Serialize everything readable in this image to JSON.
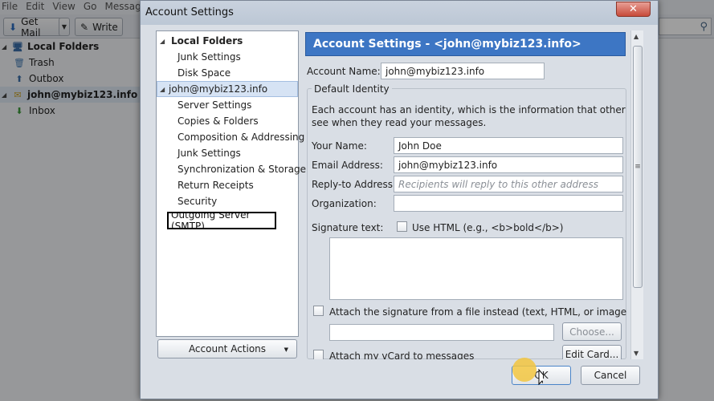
{
  "menubar": [
    "File",
    "Edit",
    "View",
    "Go",
    "Message"
  ],
  "toolbar": {
    "get_mail": "Get Mail",
    "write": "Write"
  },
  "folder_pane": {
    "local_folders": "Local Folders",
    "trash": "Trash",
    "outbox": "Outbox",
    "account": "john@mybiz123.info",
    "inbox": "Inbox"
  },
  "dialog": {
    "title": "Account Settings",
    "close": "✕",
    "tree": {
      "local_folders": "Local Folders",
      "junk_settings_1": "Junk Settings",
      "disk_space": "Disk Space",
      "account": "john@mybiz123.info",
      "server_settings": "Server Settings",
      "copies_folders": "Copies & Folders",
      "composition": "Composition & Addressing",
      "junk_settings_2": "Junk Settings",
      "sync_storage": "Synchronization & Storage",
      "return_receipts": "Return Receipts",
      "security": "Security",
      "outgoing_server": "Outgoing Server (SMTP)"
    },
    "account_actions": "Account Actions",
    "header": "Account Settings - <john@mybiz123.info>",
    "account_name_label": "Account Name:",
    "account_name_value": "john@mybiz123.info",
    "default_identity": "Default Identity",
    "identity_desc_1": "Each account has an identity, which is the information that other people",
    "identity_desc_2": "see when they read your messages.",
    "your_name_label": "Your Name:",
    "your_name_value": "John Doe",
    "email_label": "Email Address:",
    "email_value": "john@mybiz123.info",
    "reply_to_label": "Reply-to Address:",
    "reply_to_placeholder": "Recipients will reply to this other address",
    "organization_label": "Organization:",
    "organization_value": "",
    "signature_label": "Signature text:",
    "use_html": "Use HTML (e.g., <b>bold</b>)",
    "attach_sig": "Attach the signature from a file instead (text, HTML, or image):",
    "choose": "Choose...",
    "attach_vcard": "Attach my vCard to messages",
    "edit_card": "Edit Card...",
    "ok": "OK",
    "cancel": "Cancel"
  }
}
